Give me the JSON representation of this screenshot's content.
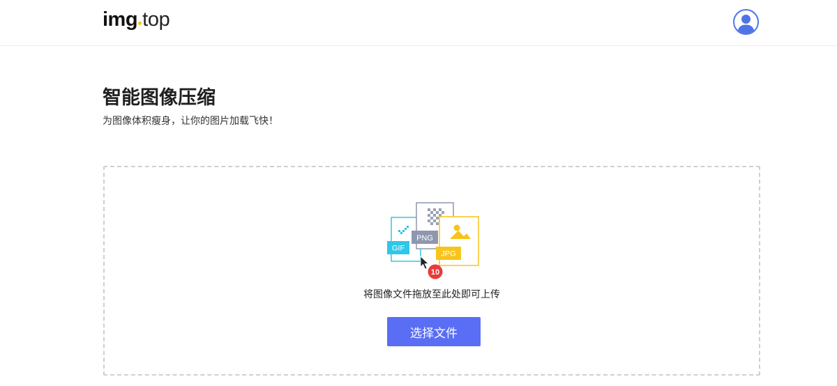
{
  "header": {
    "logo_main": "img",
    "logo_sub": "top",
    "logo_dot_color": "#f5c518",
    "avatar_icon": "user-avatar-icon"
  },
  "main": {
    "title": "智能图像压缩",
    "subtitle": "为图像体积瘦身，让你的图片加载飞快！"
  },
  "dropzone": {
    "hint": "将图像文件拖放至此处即可上传",
    "button_label": "选择文件",
    "badge_count": "10",
    "formats": [
      "GIF",
      "PNG",
      "JPG"
    ]
  },
  "colors": {
    "accent": "#5a6ef5",
    "gif": "#2ec7e6",
    "png": "#8e97ae",
    "jpg": "#f8c41c",
    "badge": "#ea3a3a"
  }
}
